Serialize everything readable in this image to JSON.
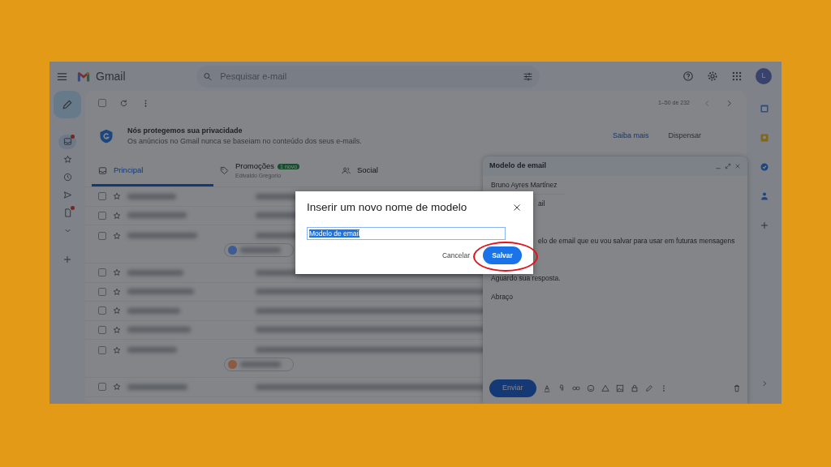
{
  "header": {
    "app_name": "Gmail",
    "search": {
      "placeholder": "Pesquisar e-mail"
    },
    "avatar": "L"
  },
  "toolbar": {
    "range": "1–50 de 232",
    "select_all_checked": false
  },
  "nav_items": [
    {
      "kind": "inbox",
      "selected": true,
      "dot": true
    },
    {
      "kind": "star",
      "selected": false,
      "dot": false
    },
    {
      "kind": "clock",
      "selected": false,
      "dot": false
    },
    {
      "kind": "send",
      "selected": false,
      "dot": false
    },
    {
      "kind": "draft",
      "selected": false,
      "dot": true
    },
    {
      "kind": "more",
      "selected": false,
      "dot": false
    }
  ],
  "privacy_banner": {
    "title": "Nós protegemos sua privacidade",
    "text": "Os anúncios no Gmail nunca se baseiam no conteúdo dos seus e-mails.",
    "links": [
      "Saiba mais",
      "Dispensar"
    ]
  },
  "tabs": [
    {
      "kind": "inbox",
      "label": "Principal",
      "selected": true
    },
    {
      "kind": "tag",
      "label": "Promoções",
      "badge": "1 novo",
      "subtitle": "Edivaldo Gregorio",
      "selected": false
    },
    {
      "kind": "people",
      "label": "Social",
      "selected": false
    }
  ],
  "email_rows": [
    {
      "checked": false
    },
    {
      "checked": false
    },
    {
      "checked": false,
      "color": "#3d5c94"
    },
    {
      "checked": false
    },
    {
      "checked": false
    },
    {
      "checked": false
    },
    {
      "checked": false
    },
    {
      "checked": false,
      "color": "#8c5a40"
    },
    {
      "checked": false
    }
  ],
  "compose": {
    "title": "Modelo de email",
    "to": "Bruno Ayres Martínez",
    "body": [
      {
        "kind": "partial",
        "text": "ail"
      },
      {
        "kind": "gap"
      },
      {
        "kind": "partial",
        "text": "elo de email que eu vou salvar para usar em futuras mensagens"
      },
      {
        "kind": "gap"
      },
      {
        "kind": "full",
        "text": "Aguardo sua resposta."
      },
      {
        "kind": "full",
        "text": "Abraço"
      }
    ],
    "send": "Enviar"
  },
  "dialog": {
    "title": "Inserir um novo nome de modelo",
    "value": "Modelo de email",
    "text_selected": true,
    "cancel": "Cancelar",
    "save": "Salvar"
  },
  "side_apps": [
    {
      "kind": "calendar"
    },
    {
      "kind": "keep"
    },
    {
      "kind": "tasks"
    },
    {
      "kind": "contacts"
    },
    {
      "kind": "add"
    }
  ]
}
